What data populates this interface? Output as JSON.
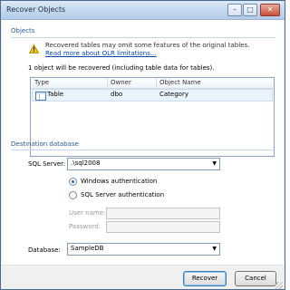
{
  "window": {
    "title": "Recover Objects",
    "controls": {
      "minimize": "–",
      "maximize": "□",
      "close": "✕"
    }
  },
  "objects": {
    "section_title": "Objects",
    "warning_icon": "warning-triangle-icon",
    "warning_text": "Recovered tables may omit some features of the original tables.",
    "link_text": "Read more about OLR limitations...",
    "info_text": "1 object will be recovered (including table data for tables).",
    "columns": [
      "Type",
      "Owner",
      "Object Name"
    ],
    "rows": [
      {
        "type": "Table",
        "owner": "dbo",
        "object_name": "Category",
        "icon": "table-icon"
      }
    ]
  },
  "destination": {
    "section_title": "Destination database",
    "sql_server_label": "SQL Server:",
    "sql_server_value": ".\\sql2008",
    "windows_auth_label": "Windows authentication",
    "sql_auth_label": "SQL Server authentication",
    "selected_auth": "windows",
    "user_name_label": "User name:",
    "password_label": "Password:",
    "database_label": "Database:",
    "database_value": "SampleDB"
  },
  "footer": {
    "recover_label": "Recover",
    "cancel_label": "Cancel"
  },
  "colors": {
    "section_title": "#2a5c9a",
    "link": "#0645ad",
    "row_selected": "#eaf2fb"
  }
}
